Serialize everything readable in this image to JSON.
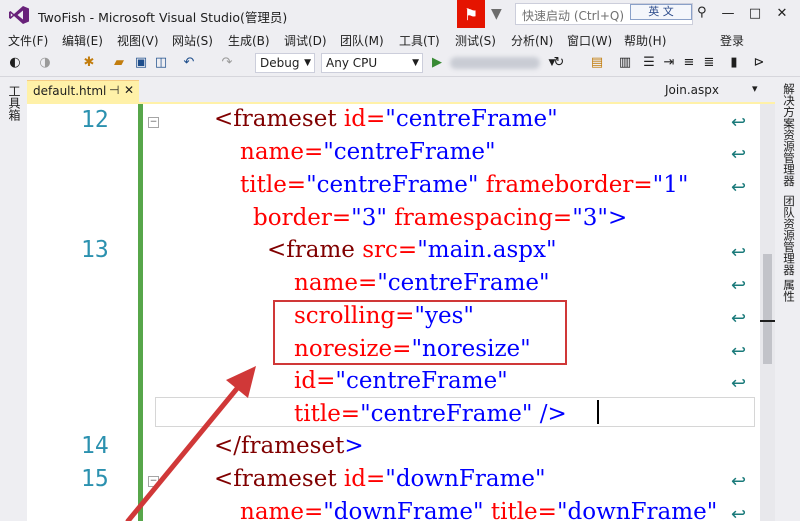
{
  "window": {
    "title": "TwoFish - Microsoft Visual Studio(管理员)",
    "quick_launch_placeholder": "快速启动 (Ctrl+Q)",
    "ime_label": "英 文"
  },
  "menu": {
    "items": [
      "文件(F)",
      "编辑(E)",
      "视图(V)",
      "网站(S)",
      "生成(B)",
      "调试(D)",
      "团队(M)",
      "工具(T)",
      "测试(S)",
      "分析(N)",
      "窗口(W)",
      "帮助(H)"
    ],
    "login": "登录"
  },
  "toolbar": {
    "config": "Debug",
    "platform": "Any CPU"
  },
  "side_panels": {
    "left": "工具箱",
    "right": [
      "解决方案资源管理器",
      "团队资源管理器",
      "属性"
    ]
  },
  "tabs": {
    "active": "default.html",
    "pin_icon": "⊣",
    "other": "Join.aspx"
  },
  "editor": {
    "line_numbers": [
      "12",
      "13",
      "14",
      "15"
    ],
    "lines": [
      {
        "el": "<frameset",
        "rest": " id=\"centreFrame\""
      },
      {
        "rest": "name=\"centreFrame\""
      },
      {
        "rest": "title=\"centreFrame\" frameborder=\"1\""
      },
      {
        "rest": "border=\"3\" framespacing=\"3\">"
      },
      {
        "el": "<frame",
        "rest": " src=\"main.aspx\""
      },
      {
        "rest": "name=\"centreFrame\""
      },
      {
        "rest": "scrolling=\"yes\""
      },
      {
        "rest": "noresize=\"noresize\""
      },
      {
        "rest": "id=\"centreFrame\""
      },
      {
        "rest": "title=\"centreFrame\" />"
      },
      {
        "el": "</frameset",
        "rest": ">"
      },
      {
        "el": "<frameset",
        "rest": " id=\"downFrame\""
      },
      {
        "rest": "name=\"downFrame\" title=\"downFrame\""
      }
    ]
  },
  "colors": {
    "annotation_red": "#d03838",
    "tab_active": "#fff1a8",
    "line_number": "#2b91af",
    "element": "#800000",
    "attribute": "#ff0000",
    "value": "#0000ff"
  }
}
